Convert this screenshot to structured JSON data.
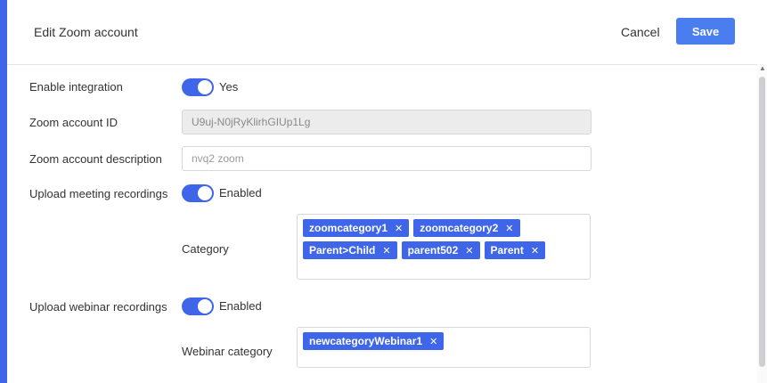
{
  "header": {
    "title": "Edit Zoom account",
    "cancel_label": "Cancel",
    "save_label": "Save"
  },
  "enable_integration": {
    "label": "Enable integration",
    "state": "Yes"
  },
  "account_id": {
    "label": "Zoom account ID",
    "value": "U9uj-N0jRyKlirhGIUp1Lg"
  },
  "account_description": {
    "label": "Zoom account description",
    "value": "nvq2 zoom"
  },
  "meeting_recordings": {
    "label": "Upload meeting recordings",
    "state": "Enabled"
  },
  "category": {
    "label": "Category",
    "tags": [
      "zoomcategory1",
      "zoomcategory2",
      "Parent>Child",
      "parent502",
      "Parent"
    ]
  },
  "webinar_recordings": {
    "label": "Upload webinar recordings",
    "state": "Enabled"
  },
  "webinar_category": {
    "label": "Webinar category",
    "tags": [
      "newcategoryWebinar1"
    ]
  },
  "icons": {
    "remove_tag": "close-icon",
    "scroll_up": "chevron-up-icon"
  },
  "colors": {
    "accent": "#3f66e8",
    "save_button": "#4a7df0"
  }
}
